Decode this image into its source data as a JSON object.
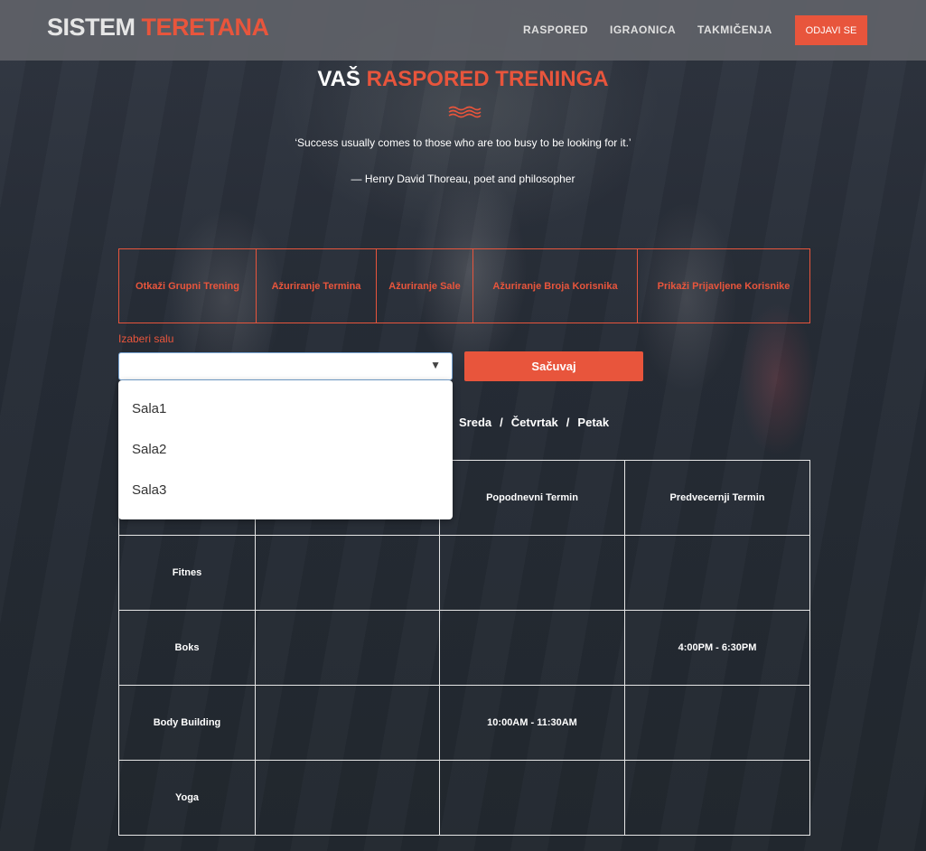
{
  "brand": {
    "part1": "SISTEM",
    "part2": "TERETANA"
  },
  "nav": {
    "raspored": "RASPORED",
    "igraonica": "IGRAONICA",
    "takmicenja": "TAKMIČENJA",
    "logout": "ODJAVI SE"
  },
  "heading": {
    "part1": "VAŠ",
    "part2": "RASPORED TRENINGA"
  },
  "quote": "‘Success usually comes to those who are too busy to be looking for it.’",
  "author": "— Henry David Thoreau, poet and philosopher",
  "actions": [
    "Otkaži Grupni Trening",
    "Ažuriranje Termina",
    "Ažuriranje Sale",
    "Ažuriranje Broja Korisnika",
    "Prikaži Prijavljene Korisnike"
  ],
  "select": {
    "label": "Izaberi salu",
    "value": "",
    "options": [
      "Sala1",
      "Sala2",
      "Sala3"
    ]
  },
  "save_label": "Sačuvaj",
  "days_visible": [
    "Sreda",
    "Četvrtak",
    "Petak"
  ],
  "days_sep": "/",
  "table": {
    "headers": [
      "",
      "",
      "Popodnevni Termin",
      "Predvecernji Termin"
    ],
    "rows": [
      {
        "name": "Fitnes",
        "cells": [
          "",
          "",
          ""
        ]
      },
      {
        "name": "Boks",
        "cells": [
          "",
          "",
          "4:00PM - 6:30PM"
        ]
      },
      {
        "name": "Body Building",
        "cells": [
          "",
          "10:00AM - 11:30AM",
          ""
        ]
      },
      {
        "name": "Yoga",
        "cells": [
          "",
          "",
          ""
        ]
      }
    ]
  },
  "colors": {
    "accent": "#e8553c",
    "navbar": "#5f6268"
  }
}
